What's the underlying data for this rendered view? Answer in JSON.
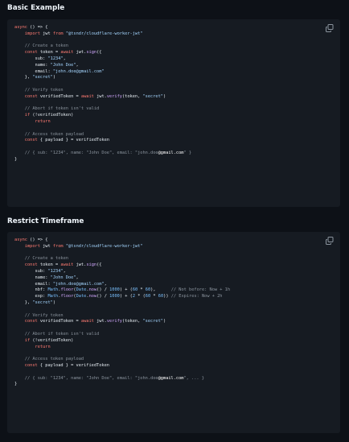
{
  "sections": [
    {
      "title": "Basic Example",
      "lines": [
        [
          {
            "t": "async",
            "c": "kw"
          },
          {
            "t": " () => {",
            "c": "pl"
          }
        ],
        [
          {
            "t": "    import",
            "c": "kw"
          },
          {
            "t": " jwt ",
            "c": "pl"
          },
          {
            "t": "from",
            "c": "kw"
          },
          {
            "t": " ",
            "c": "pl"
          },
          {
            "t": "\"@tsndr/cloudflare-worker-jwt\"",
            "c": "str"
          }
        ],
        [],
        [
          {
            "t": "    // Create a token",
            "c": "cm"
          }
        ],
        [
          {
            "t": "    const",
            "c": "kw"
          },
          {
            "t": " token = ",
            "c": "pl"
          },
          {
            "t": "await",
            "c": "kw"
          },
          {
            "t": " jwt.",
            "c": "pl"
          },
          {
            "t": "sign",
            "c": "fn"
          },
          {
            "t": "({",
            "c": "pl"
          }
        ],
        [
          {
            "t": "        sub: ",
            "c": "pl"
          },
          {
            "t": "\"1234\"",
            "c": "str"
          },
          {
            "t": ",",
            "c": "pl"
          }
        ],
        [
          {
            "t": "        name: ",
            "c": "pl"
          },
          {
            "t": "\"John Doe\"",
            "c": "str"
          },
          {
            "t": ",",
            "c": "pl"
          }
        ],
        [
          {
            "t": "        email: ",
            "c": "pl"
          },
          {
            "t": "\"john.doe@gmail.com\"",
            "c": "str"
          }
        ],
        [
          {
            "t": "    }, ",
            "c": "pl"
          },
          {
            "t": "\"secret\"",
            "c": "str"
          },
          {
            "t": ")",
            "c": "pl"
          }
        ],
        [],
        [
          {
            "t": "    // Verify token",
            "c": "cm"
          }
        ],
        [
          {
            "t": "    const",
            "c": "kw"
          },
          {
            "t": " verifiedToken = ",
            "c": "pl"
          },
          {
            "t": "await",
            "c": "kw"
          },
          {
            "t": " jwt.",
            "c": "pl"
          },
          {
            "t": "verify",
            "c": "fn"
          },
          {
            "t": "(token, ",
            "c": "pl"
          },
          {
            "t": "\"secret\"",
            "c": "str"
          },
          {
            "t": ")",
            "c": "pl"
          }
        ],
        [],
        [
          {
            "t": "    // Abort if token isn't valid",
            "c": "cm"
          }
        ],
        [
          {
            "t": "    if",
            "c": "kw"
          },
          {
            "t": " (!verifiedToken)",
            "c": "pl"
          }
        ],
        [
          {
            "t": "        return",
            "c": "kw"
          }
        ],
        [],
        [
          {
            "t": "    // Access token payload",
            "c": "cm"
          }
        ],
        [
          {
            "t": "    const",
            "c": "kw"
          },
          {
            "t": " { payload } = verifiedToken",
            "c": "pl"
          }
        ],
        [],
        [
          {
            "t": "    // { sub: \"1234\", name: \"John Doe\", email: \"john.doe",
            "c": "cm"
          },
          {
            "t": "@gmail.com",
            "c": "hl"
          },
          {
            "t": "\" }",
            "c": "cm"
          }
        ],
        [
          {
            "t": "}",
            "c": "pl"
          }
        ]
      ]
    },
    {
      "title": "Restrict Timeframe",
      "lines": [
        [
          {
            "t": "async",
            "c": "kw"
          },
          {
            "t": " () => {",
            "c": "pl"
          }
        ],
        [
          {
            "t": "    import",
            "c": "kw"
          },
          {
            "t": " jwt ",
            "c": "pl"
          },
          {
            "t": "from",
            "c": "kw"
          },
          {
            "t": " ",
            "c": "pl"
          },
          {
            "t": "\"@tsndr/cloudflare-worker-jwt\"",
            "c": "str"
          }
        ],
        [],
        [
          {
            "t": "    // Create a token",
            "c": "cm"
          }
        ],
        [
          {
            "t": "    const",
            "c": "kw"
          },
          {
            "t": " token = ",
            "c": "pl"
          },
          {
            "t": "await",
            "c": "kw"
          },
          {
            "t": " jwt.",
            "c": "pl"
          },
          {
            "t": "sign",
            "c": "fn"
          },
          {
            "t": "({",
            "c": "pl"
          }
        ],
        [
          {
            "t": "        sub: ",
            "c": "pl"
          },
          {
            "t": "\"1234\"",
            "c": "str"
          },
          {
            "t": ",",
            "c": "pl"
          }
        ],
        [
          {
            "t": "        name: ",
            "c": "pl"
          },
          {
            "t": "\"John Doe\"",
            "c": "str"
          },
          {
            "t": ",",
            "c": "pl"
          }
        ],
        [
          {
            "t": "        email: ",
            "c": "pl"
          },
          {
            "t": "\"john.doe@gmail.com\"",
            "c": "str"
          },
          {
            "t": ",",
            "c": "pl"
          }
        ],
        [
          {
            "t": "        nbf: ",
            "c": "pl"
          },
          {
            "t": "Math",
            "c": "prop"
          },
          {
            "t": ".",
            "c": "pl"
          },
          {
            "t": "floor",
            "c": "fn"
          },
          {
            "t": "(",
            "c": "pl"
          },
          {
            "t": "Date",
            "c": "prop"
          },
          {
            "t": ".",
            "c": "pl"
          },
          {
            "t": "now",
            "c": "fn"
          },
          {
            "t": "() / ",
            "c": "pl"
          },
          {
            "t": "1000",
            "c": "num"
          },
          {
            "t": ") + (",
            "c": "pl"
          },
          {
            "t": "60",
            "c": "num"
          },
          {
            "t": " * ",
            "c": "pl"
          },
          {
            "t": "60",
            "c": "num"
          },
          {
            "t": "),      ",
            "c": "pl"
          },
          {
            "t": "// Not before: Now + 1h",
            "c": "cm"
          }
        ],
        [
          {
            "t": "        exp: ",
            "c": "pl"
          },
          {
            "t": "Math",
            "c": "prop"
          },
          {
            "t": ".",
            "c": "pl"
          },
          {
            "t": "floor",
            "c": "fn"
          },
          {
            "t": "(",
            "c": "pl"
          },
          {
            "t": "Date",
            "c": "prop"
          },
          {
            "t": ".",
            "c": "pl"
          },
          {
            "t": "now",
            "c": "fn"
          },
          {
            "t": "() / ",
            "c": "pl"
          },
          {
            "t": "1000",
            "c": "num"
          },
          {
            "t": ") + (",
            "c": "pl"
          },
          {
            "t": "2",
            "c": "num"
          },
          {
            "t": " * (",
            "c": "pl"
          },
          {
            "t": "60",
            "c": "num"
          },
          {
            "t": " * ",
            "c": "pl"
          },
          {
            "t": "60",
            "c": "num"
          },
          {
            "t": ")) ",
            "c": "pl"
          },
          {
            "t": "// Expires: Now + 2h",
            "c": "cm"
          }
        ],
        [
          {
            "t": "    }, ",
            "c": "pl"
          },
          {
            "t": "\"secret\"",
            "c": "str"
          },
          {
            "t": ")",
            "c": "pl"
          }
        ],
        [],
        [
          {
            "t": "    // Verify token",
            "c": "cm"
          }
        ],
        [
          {
            "t": "    const",
            "c": "kw"
          },
          {
            "t": " verifiedToken = ",
            "c": "pl"
          },
          {
            "t": "await",
            "c": "kw"
          },
          {
            "t": " jwt.",
            "c": "pl"
          },
          {
            "t": "verify",
            "c": "fn"
          },
          {
            "t": "(token, ",
            "c": "pl"
          },
          {
            "t": "\"secret\"",
            "c": "str"
          },
          {
            "t": ")",
            "c": "pl"
          }
        ],
        [],
        [
          {
            "t": "    // Abort if token isn't valid",
            "c": "cm"
          }
        ],
        [
          {
            "t": "    if",
            "c": "kw"
          },
          {
            "t": " (!verifiedToken)",
            "c": "pl"
          }
        ],
        [
          {
            "t": "        return",
            "c": "kw"
          }
        ],
        [],
        [
          {
            "t": "    // Access token payload",
            "c": "cm"
          }
        ],
        [
          {
            "t": "    const",
            "c": "kw"
          },
          {
            "t": " { payload } = verifiedToken",
            "c": "pl"
          }
        ],
        [],
        [
          {
            "t": "    // { sub: \"1234\", name: \"John Doe\", email: \"john.doe",
            "c": "cm"
          },
          {
            "t": "@gmail.com",
            "c": "hl"
          },
          {
            "t": "\", ... }",
            "c": "cm"
          }
        ],
        [
          {
            "t": "}",
            "c": "pl"
          }
        ]
      ]
    }
  ],
  "icons": {
    "copy": "copy-icon"
  },
  "colors": {
    "background": "#0d1117",
    "code_background": "#161b22",
    "keyword": "#ff7b72",
    "string": "#a5d6ff",
    "comment": "#8b949e",
    "function": "#d2a8ff",
    "number": "#79c0ff",
    "text": "#e6edf3"
  }
}
